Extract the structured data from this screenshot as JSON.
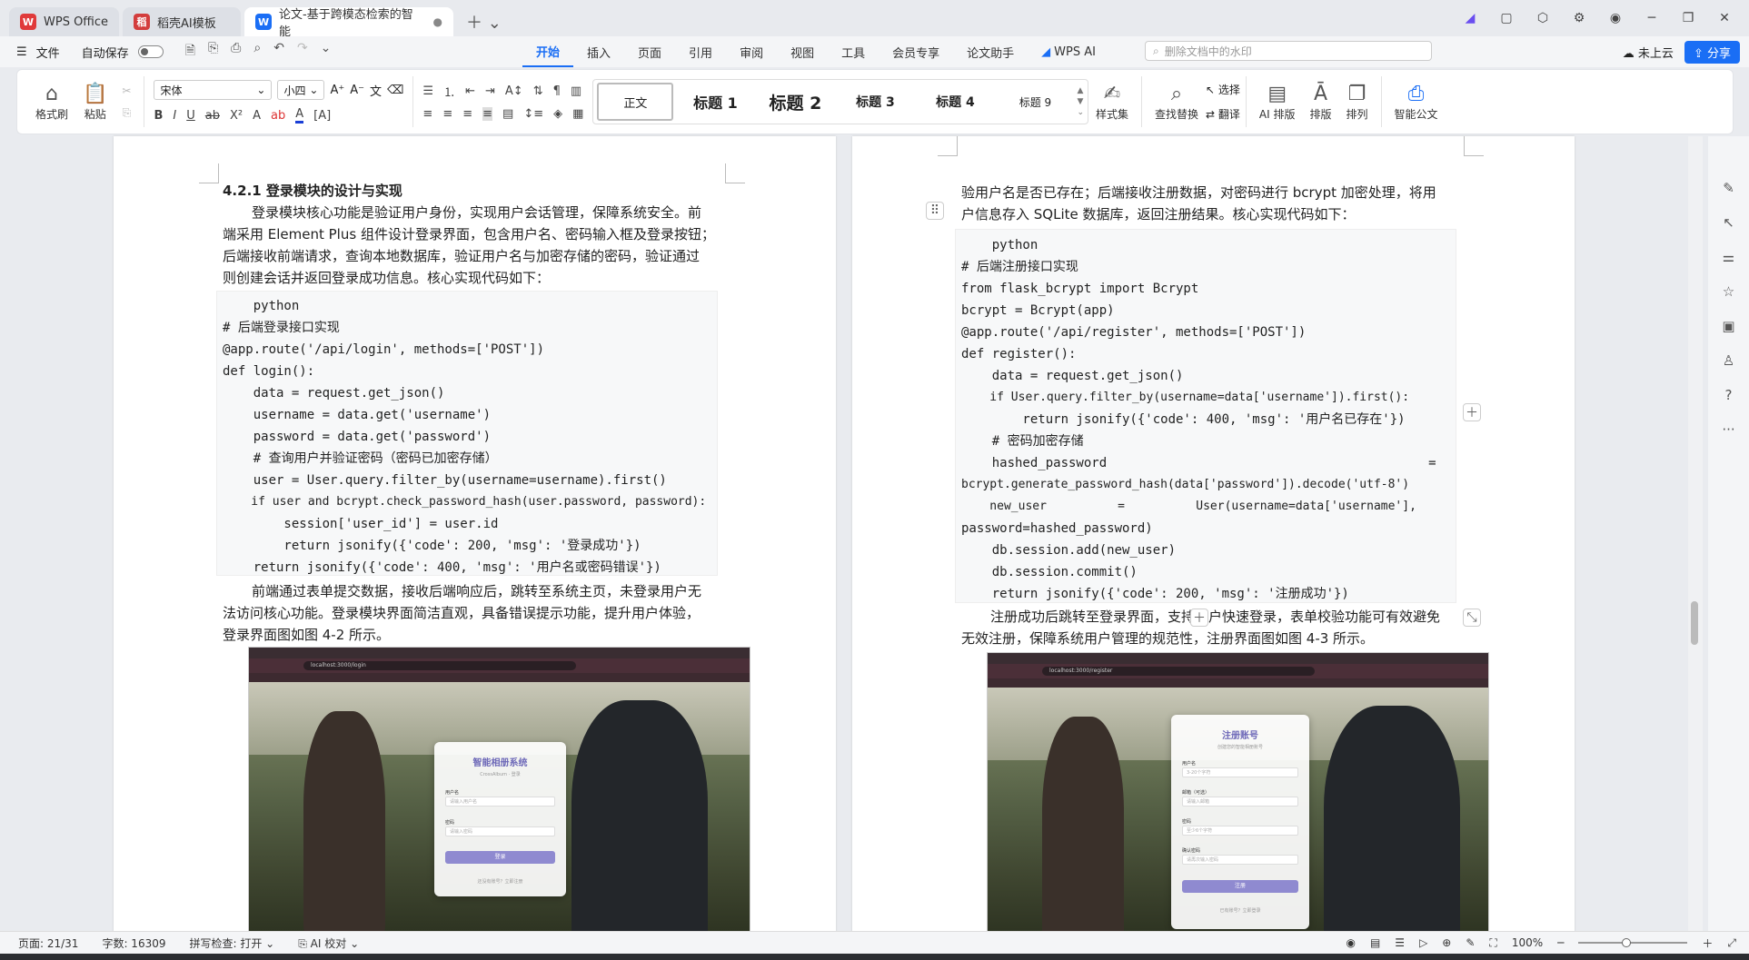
{
  "tabs": [
    {
      "label": "WPS Office",
      "logo": "W",
      "color": "#e03a3a"
    },
    {
      "label": "稻壳AI模板",
      "logo": "稻",
      "color": "#d33d3d"
    },
    {
      "label": "论文-基于跨模态检索的智能",
      "logo": "W",
      "color": "#1a6ef5"
    }
  ],
  "menubar": {
    "file": "文件",
    "autosave": "自动保存",
    "tabs": [
      "开始",
      "插入",
      "页面",
      "引用",
      "审阅",
      "视图",
      "工具",
      "会员专享",
      "论文助手",
      "WPS AI"
    ],
    "search_placeholder": "删除文档中的水印",
    "cloud": "未上云",
    "share": "分享"
  },
  "ribbon": {
    "format_painter": "格式刷",
    "paste": "粘贴",
    "font_name": "宋体",
    "font_size": "小四",
    "styles": [
      "正文",
      "标题 1",
      "标题 2",
      "标题 3",
      "标题 4",
      "标题 9"
    ],
    "style_set": "样式集",
    "find_replace": "查找替换",
    "select": "选择",
    "translate": "翻译",
    "ai_layout": "AI 排版",
    "layout": "排版",
    "arrange": "排列",
    "smart_doc": "智能公文"
  },
  "left_page": {
    "heading": "4.2.1 登录模块的设计与实现",
    "para1": [
      "登录模块核心功能是验证用户身份，实现用户会话管理，保障系统安全。前",
      "端采用 Element Plus 组件设计登录界面，包含用户名、密码输入框及登录按钮；",
      "后端接收前端请求，查询本地数据库，验证用户名与加密存储的密码，验证通过",
      "则创建会话并返回登录成功信息。核心实现代码如下："
    ],
    "code": [
      "    python",
      "# 后端登录接口实现",
      "@app.route('/api/login', methods=['POST'])",
      "def login():",
      "    data = request.get_json()",
      "    username = data.get('username')",
      "    password = data.get('password')",
      "    # 查询用户并验证密码（密码已加密存储）",
      "    user = User.query.filter_by(username=username).first()",
      "    if user and bcrypt.check_password_hash(user.password, password):",
      "        session['user_id'] = user.id",
      "        return jsonify({'code': 200, 'msg': '登录成功'})",
      "    return jsonify({'code': 400, 'msg': '用户名或密码错误'})"
    ],
    "para2": [
      "前端通过表单提交数据，接收后端响应后，跳转至系统主页，未登录用户无",
      "法访问核心功能。登录模块界面简洁直观，具备错误提示功能，提升用户体验，",
      "登录界面图如图 4-2 所示。"
    ],
    "screenshot": {
      "url": "localhost:3000/login",
      "title": "智能相册系统",
      "subtitle": "CrossAlbum · 登录",
      "fields": [
        {
          "label": "用户名",
          "placeholder": "请输入用户名"
        },
        {
          "label": "密码",
          "placeholder": "请输入密码"
        }
      ],
      "button": "登录",
      "footer": "还没有账号？立即注册"
    }
  },
  "right_page": {
    "para1": [
      "验用户名是否已存在；后端接收注册数据，对密码进行 bcrypt 加密处理，将用",
      "户信息存入 SQLite 数据库，返回注册结果。核心实现代码如下："
    ],
    "code": [
      "    python",
      "# 后端注册接口实现",
      "from flask_bcrypt import Bcrypt",
      "bcrypt = Bcrypt(app)",
      "@app.route('/api/register', methods=['POST'])",
      "def register():",
      "    data = request.get_json()",
      "    if User.query.filter_by(username=data['username']).first():",
      "        return jsonify({'code': 400, 'msg': '用户名已存在'})",
      "    # 密码加密存储",
      "    hashed_password                                          =",
      "bcrypt.generate_password_hash(data['password']).decode('utf-8')",
      "    new_user          =          User(username=data['username'],",
      "password=hashed_password)",
      "    db.session.add(new_user)",
      "    db.session.commit()",
      "    return jsonify({'code': 200, 'msg': '注册成功'})"
    ],
    "para2": [
      "注册成功后跳转至登录界面，支持用户快速登录，表单校验功能可有效避免",
      "无效注册，保障系统用户管理的规范性，注册界面图如图 4-3 所示。"
    ],
    "screenshot": {
      "url": "localhost:3000/register",
      "title": "注册账号",
      "subtitle": "创建您的智能相册账号",
      "fields": [
        {
          "label": "用户名",
          "placeholder": "3-20个字符"
        },
        {
          "label": "邮箱（可选）",
          "placeholder": "请输入邮箱"
        },
        {
          "label": "密码",
          "placeholder": "至少6个字符"
        },
        {
          "label": "确认密码",
          "placeholder": "请再次输入密码"
        }
      ],
      "button": "注册",
      "footer": "已有账号？立即登录"
    }
  },
  "statusbar": {
    "page": "页面: 21/31",
    "words": "字数: 16309",
    "spellcheck": "拼写检查: 打开",
    "ai_proof": "AI 校对",
    "zoom": "100%"
  }
}
